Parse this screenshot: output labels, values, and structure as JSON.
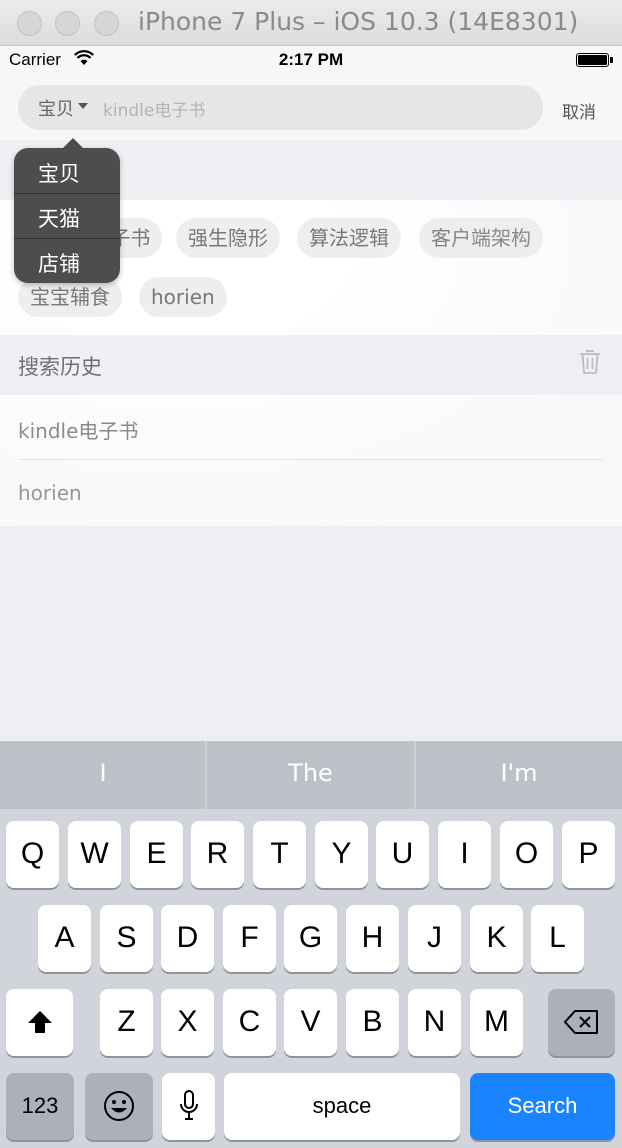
{
  "window": {
    "title": "iPhone 7 Plus – iOS 10.3 (14E8301)"
  },
  "status_bar": {
    "carrier": "Carrier",
    "time": "2:17 PM"
  },
  "search_bar": {
    "scope": "宝贝",
    "placeholder": "kindle电子书",
    "cancel": "取消"
  },
  "scope_menu": {
    "items": [
      "宝贝",
      "天猫",
      "店铺"
    ]
  },
  "hot_tags": [
    "kindle电子书",
    "强生隐形",
    "算法逻辑",
    "客户端架构",
    "宝宝辅食",
    "horien"
  ],
  "history": {
    "title": "搜索历史",
    "items": [
      "kindle电子书",
      "horien"
    ]
  },
  "keyboard": {
    "suggestions": [
      "I",
      "The",
      "I'm"
    ],
    "row1": [
      "Q",
      "W",
      "E",
      "R",
      "T",
      "Y",
      "U",
      "I",
      "O",
      "P"
    ],
    "row2": [
      "A",
      "S",
      "D",
      "F",
      "G",
      "H",
      "J",
      "K",
      "L"
    ],
    "row3": [
      "Z",
      "X",
      "C",
      "V",
      "B",
      "N",
      "M"
    ],
    "numbers_key": "123",
    "space_key": "space",
    "return_key": "Search"
  },
  "colors": {
    "accent": "#1a84ff",
    "popover": "#4d4d4d",
    "background": "#efeff4"
  },
  "icons": [
    "wifi-icon",
    "battery-icon",
    "dropdown-caret-icon",
    "trash-icon",
    "shift-icon",
    "backspace-icon",
    "emoji-icon",
    "microphone-icon"
  ]
}
